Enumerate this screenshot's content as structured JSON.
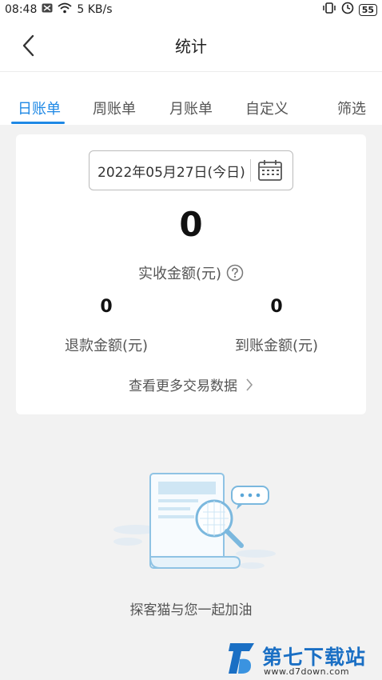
{
  "status_bar": {
    "time": "08:48",
    "speed": "5 KB/s",
    "battery": "55"
  },
  "header": {
    "title": "统计"
  },
  "tabs": [
    {
      "label": "日账单",
      "active": true
    },
    {
      "label": "周账单",
      "active": false
    },
    {
      "label": "月账单",
      "active": false
    },
    {
      "label": "自定义",
      "active": false
    },
    {
      "label": "筛选",
      "active": false
    }
  ],
  "summary": {
    "date": "2022年05月27日(今日)",
    "received_amount": "0",
    "received_label": "实收金额(元)",
    "refund_amount": "0",
    "refund_label": "退款金额(元)",
    "arrival_amount": "0",
    "arrival_label": "到账金额(元)",
    "more_link": "查看更多交易数据"
  },
  "empty_state": {
    "message": "探客猫与您一起加油"
  },
  "watermark": {
    "title": "第七下载站",
    "url": "www.d7down.com"
  },
  "colors": {
    "accent": "#1e88e5",
    "background": "#f2f2f2"
  },
  "icons": [
    "back-arrow-icon",
    "calendar-icon",
    "help-icon",
    "chevron-right-icon",
    "wifi-icon",
    "battery-icon"
  ]
}
